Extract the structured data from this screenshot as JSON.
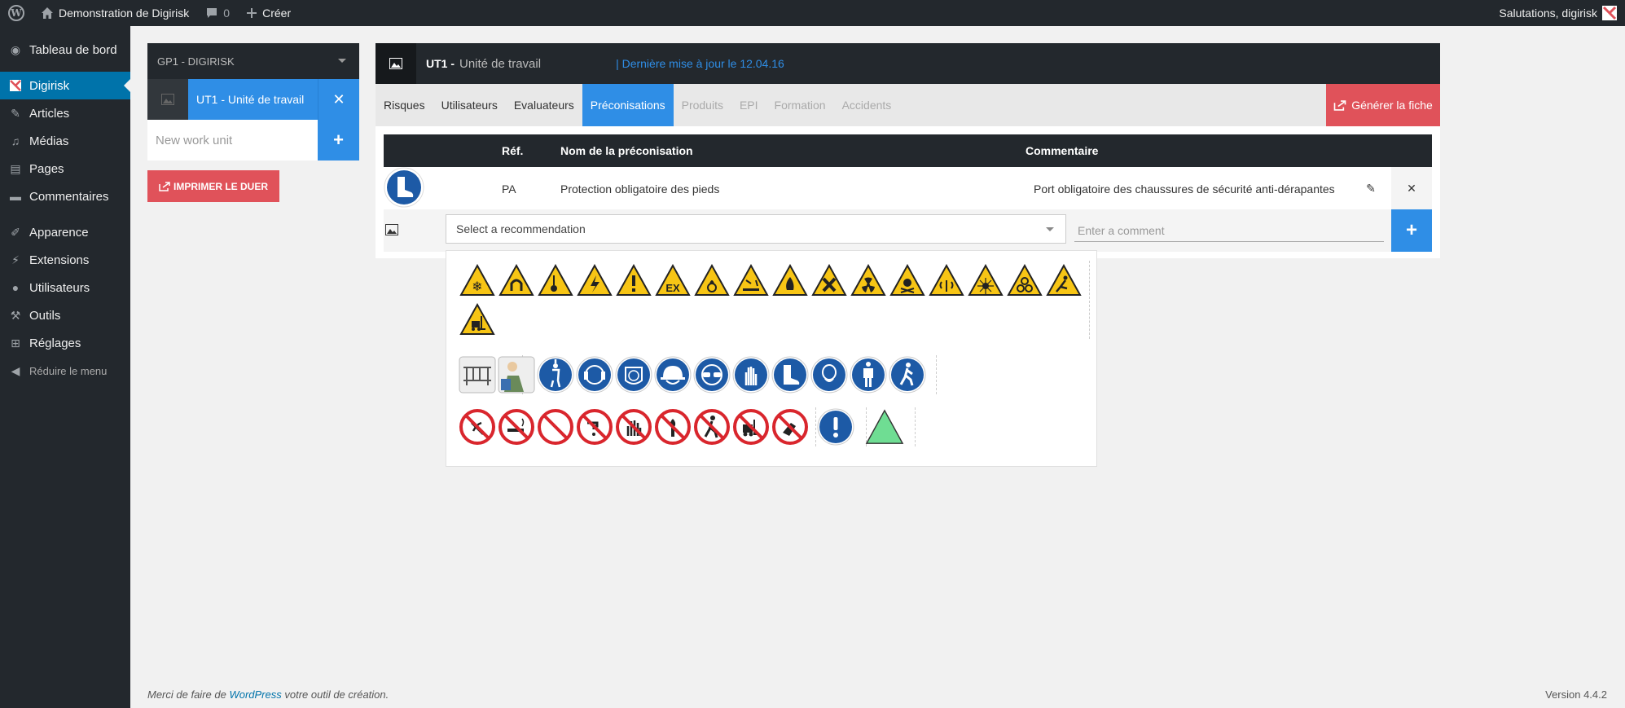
{
  "adminbar": {
    "site_name": "Demonstration de Digirisk",
    "comments_count": "0",
    "create_label": "Créer",
    "greeting": "Salutations, digirisk"
  },
  "menu": {
    "items": [
      {
        "label": "Tableau de bord",
        "icon": "dashboard-icon"
      },
      {
        "label": "Digirisk",
        "icon": "digirisk-icon"
      },
      {
        "label": "Articles",
        "icon": "pin-icon"
      },
      {
        "label": "Médias",
        "icon": "media-icon"
      },
      {
        "label": "Pages",
        "icon": "pages-icon"
      },
      {
        "label": "Commentaires",
        "icon": "comment-icon"
      },
      {
        "label": "Apparence",
        "icon": "brush-icon"
      },
      {
        "label": "Extensions",
        "icon": "plugin-icon"
      },
      {
        "label": "Utilisateurs",
        "icon": "users-icon"
      },
      {
        "label": "Outils",
        "icon": "tools-icon"
      },
      {
        "label": "Réglages",
        "icon": "settings-icon"
      },
      {
        "label": "Réduire le menu",
        "icon": "collapse-icon"
      }
    ]
  },
  "group": {
    "title": "GP1 - DIGIRISK",
    "unit_label": "UT1 - Unité de travail",
    "new_placeholder": "New work unit",
    "print_label": "IMPRIMER LE DUER"
  },
  "unit": {
    "ref": "UT1 -",
    "name": "Unité de travail",
    "updated": "| Dernière mise à jour le 12.04.16",
    "generate_label": "Générer la fiche"
  },
  "tabs": [
    {
      "label": "Risques",
      "state": "normal"
    },
    {
      "label": "Utilisateurs",
      "state": "normal"
    },
    {
      "label": "Evaluateurs",
      "state": "normal"
    },
    {
      "label": "Préconisations",
      "state": "active"
    },
    {
      "label": "Produits",
      "state": "disabled"
    },
    {
      "label": "EPI",
      "state": "disabled"
    },
    {
      "label": "Formation",
      "state": "disabled"
    },
    {
      "label": "Accidents",
      "state": "disabled"
    }
  ],
  "table": {
    "headers": {
      "ref": "Réf.",
      "name": "Nom de la préconisation",
      "comment": "Commentaire"
    },
    "rows": [
      {
        "ref": "PA",
        "name": "Protection obligatoire des pieds",
        "comment": "Port obligatoire des chaussures de sécurité anti-dérapantes"
      }
    ]
  },
  "add_form": {
    "select_placeholder": "Select a recommendation",
    "comment_placeholder": "Enter a comment"
  },
  "footer": {
    "text_before": "Merci de faire de ",
    "link": "WordPress",
    "text_after": " votre outil de création.",
    "version": "Version 4.4.2"
  },
  "colors": {
    "blue": "#2f8ee6",
    "red": "#e0525a",
    "dark": "#23282d",
    "wp_blue": "#0073aa"
  }
}
